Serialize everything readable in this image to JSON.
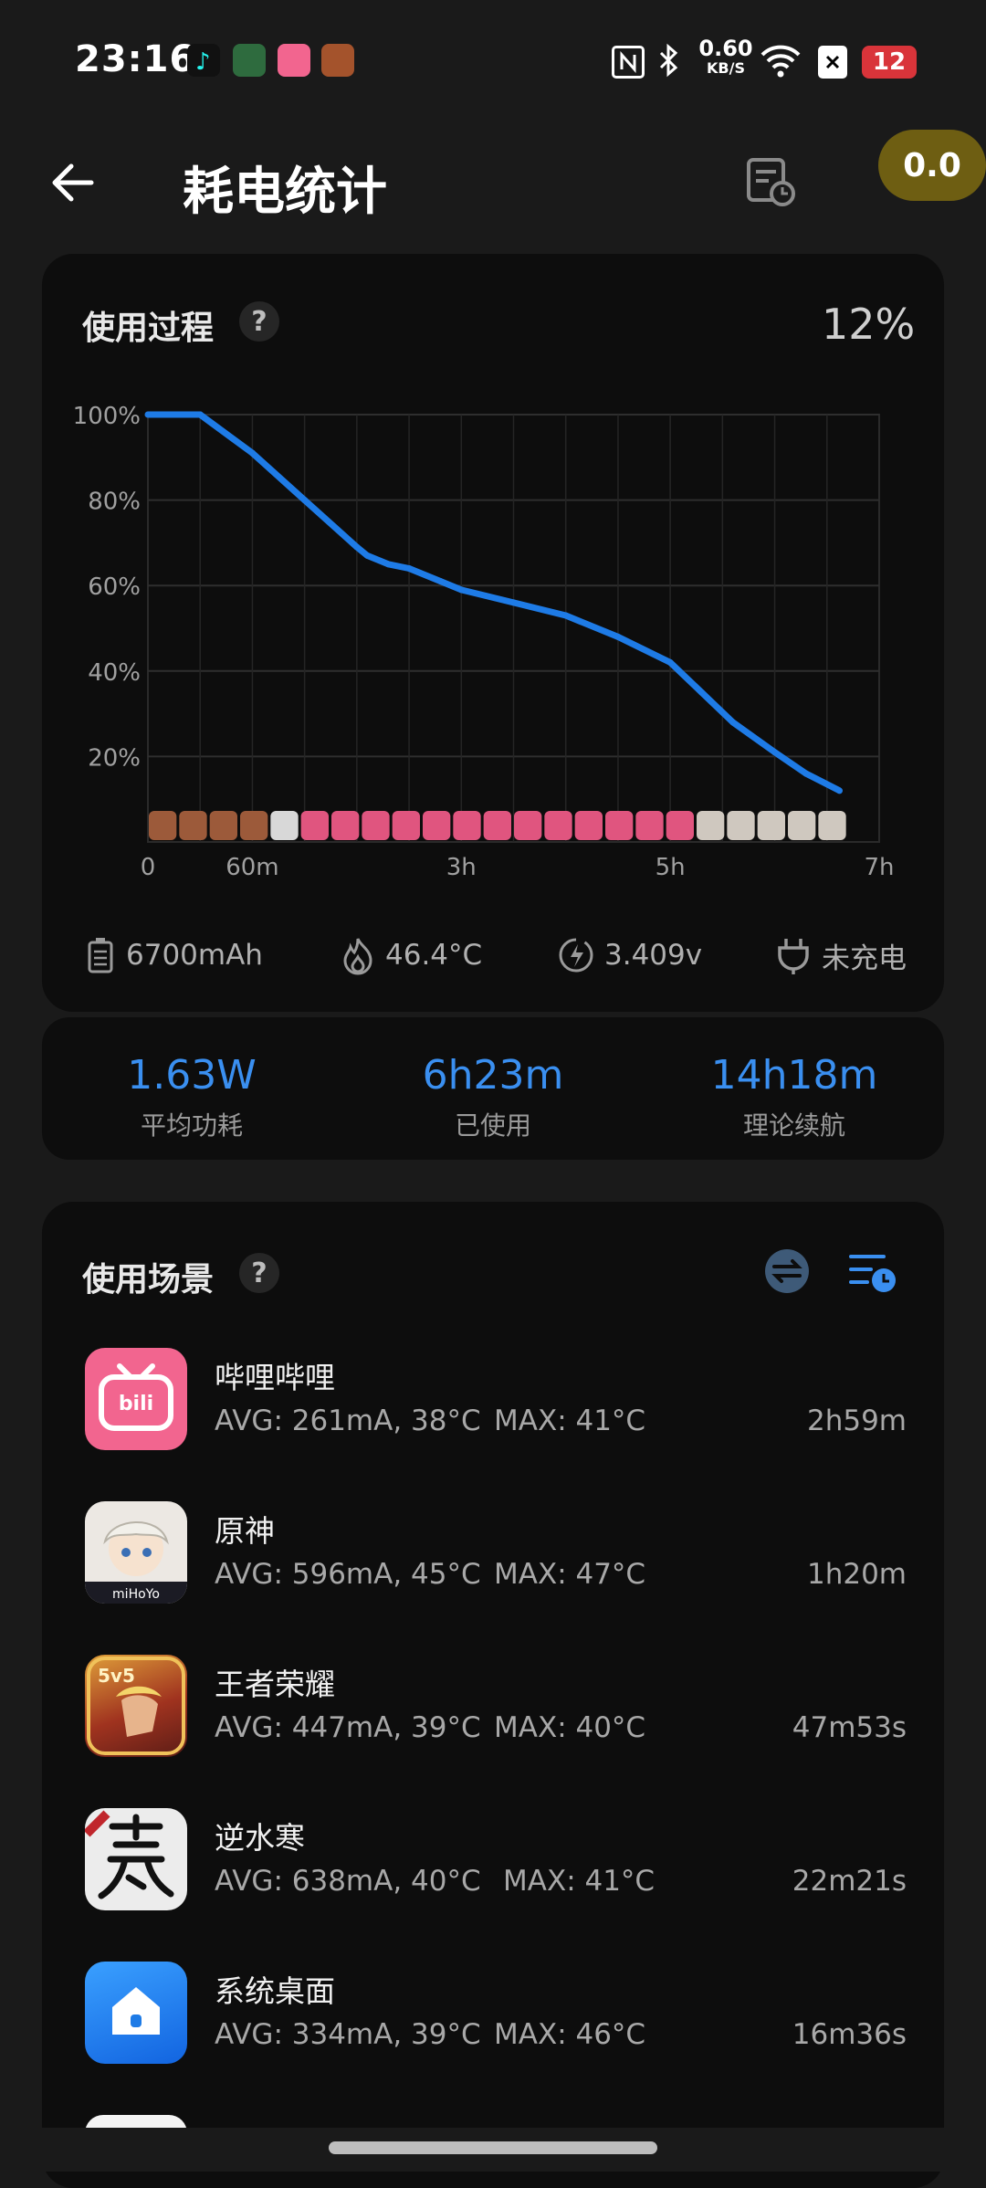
{
  "status_bar": {
    "time": "23:16",
    "net_speed_value": "0.60",
    "net_speed_unit": "KB/S",
    "battery": "12",
    "icons": [
      "nfc-icon",
      "bluetooth-icon",
      "wifi-icon",
      "sim-off-icon"
    ]
  },
  "header": {
    "title": "耗电统计",
    "float_value": "0.0"
  },
  "usage_card": {
    "title": "使用过程",
    "help": "?",
    "level": "12%",
    "capacity": "6700mAh",
    "temperature": "46.4°C",
    "voltage": "3.409v",
    "charging": "未充电"
  },
  "chart_data": {
    "type": "line",
    "y_ticks": [
      "100%",
      "80%",
      "60%",
      "40%",
      "20%"
    ],
    "x_ticks": [
      "0",
      "60m",
      "3h",
      "5h",
      "7h"
    ],
    "xlim_hours": [
      0,
      7
    ],
    "ylim": [
      0,
      100
    ],
    "series": [
      {
        "x": [
          0,
          0.5,
          1,
          1.5,
          2,
          2.1,
          2.3,
          2.5,
          2.8,
          3.0,
          3.5,
          4.0,
          4.5,
          5.0,
          5.3,
          5.6,
          6.0,
          6.3,
          6.62
        ],
        "values": [
          100,
          100,
          91,
          80,
          69,
          67,
          65,
          64,
          61,
          59,
          56,
          53,
          48,
          42,
          35,
          28,
          21,
          16,
          12
        ]
      }
    ],
    "app_timeline": [
      "王者荣耀",
      "王者荣耀",
      "王者荣耀",
      "王者荣耀",
      "逆水寒",
      "哔哩哔哩",
      "哔哩哔哩",
      "哔哩哔哩",
      "哔哩哔哩",
      "哔哩哔哩",
      "哔哩哔哩",
      "哔哩哔哩",
      "哔哩哔哩",
      "哔哩哔哩",
      "哔哩哔哩",
      "哔哩哔哩",
      "哔哩哔哩",
      "哔哩哔哩",
      "原神",
      "原神",
      "原神",
      "原神",
      "原神"
    ]
  },
  "summary": [
    {
      "value": "1.63W",
      "label": "平均功耗"
    },
    {
      "value": "6h23m",
      "label": "已使用"
    },
    {
      "value": "14h18m",
      "label": "理论续航"
    }
  ],
  "scenes": {
    "title": "使用场景",
    "help": "?",
    "apps": [
      {
        "name": "哔哩哔哩",
        "avg": "AVG: 261mA, 38°C",
        "max": "MAX:  41°C",
        "duration": "2h59m",
        "icon": "bilibili-app-icon",
        "color": "#f2658f"
      },
      {
        "name": "原神",
        "avg": "AVG: 596mA, 45°C",
        "max": "MAX:  47°C",
        "duration": "1h20m",
        "icon": "genshin-app-icon",
        "color": "#e9e4df"
      },
      {
        "name": "王者荣耀",
        "avg": "AVG: 447mA, 39°C",
        "max": "MAX:  40°C",
        "duration": "47m53s",
        "icon": "honor-of-kings-app-icon",
        "color": "#b5452a"
      },
      {
        "name": "逆水寒",
        "avg": "AVG: 638mA, 40°C",
        "max": "MAX:  41°C",
        "duration": "22m21s",
        "icon": "nishuihan-app-icon",
        "color": "#e8e8e8"
      },
      {
        "name": "系统桌面",
        "avg": "AVG: 334mA, 39°C",
        "max": "MAX:  46°C",
        "duration": "16m36s",
        "icon": "launcher-app-icon",
        "color": "#1e88f0"
      }
    ]
  },
  "colors": {
    "accent": "#3a8ff0",
    "line": "#1e7be6",
    "card": "#0d0d0d",
    "background": "#1a1a1a"
  }
}
